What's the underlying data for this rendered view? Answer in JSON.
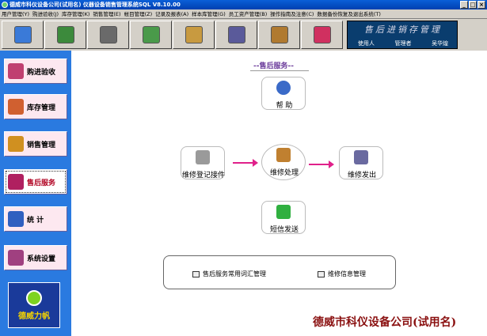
{
  "window": {
    "title": "德威市科仪设备公司(试用名) 仪器设备销售管理系统SQL V8.10.00",
    "buttons": [
      "_",
      "□",
      "×"
    ]
  },
  "menu": [
    "用户管理(Y)",
    "购进验收(J)",
    "库存管理(K)",
    "销售管理(E)",
    "帐目管理(Z)",
    "记录及报表(A)",
    "样本库管理(G)",
    "员工资产管理(B)",
    "操作指南及注意(C)",
    "数据备份恢复及退出系统(T)"
  ],
  "toolbar": {
    "icons": [
      {
        "name": "refresh-icon",
        "color": "#3a7ad8"
      },
      {
        "name": "ledger-icon",
        "color": "#3c8a3c"
      },
      {
        "name": "search-icon",
        "color": "#6a6a6a"
      },
      {
        "name": "spreadsheet-icon",
        "color": "#4a9a4a"
      },
      {
        "name": "box-icon",
        "color": "#c89a40"
      },
      {
        "name": "id-card-icon",
        "color": "#5a5a9a"
      },
      {
        "name": "book-icon",
        "color": "#b07a30"
      },
      {
        "name": "exit-door-icon",
        "color": "#d03060"
      }
    ],
    "brand_title": "售后进销存管理",
    "user_label": "使用人",
    "role_label": "管理者",
    "user_name": "吴华煌"
  },
  "sidebar": {
    "items": [
      {
        "label": "购进验收",
        "icon": "purchase-icon",
        "color": "#c04070"
      },
      {
        "label": "库存管理",
        "icon": "inventory-icon",
        "color": "#d06030"
      },
      {
        "label": "销售管理",
        "icon": "shopping-cart-icon",
        "color": "#d09020"
      },
      {
        "label": "售后服务",
        "icon": "after-sales-icon",
        "color": "#b02060"
      },
      {
        "label": "统  计",
        "icon": "statistics-icon",
        "color": "#3060c0"
      },
      {
        "label": "系统设置",
        "icon": "settings-icon",
        "color": "#a04080"
      }
    ],
    "active_index": 3,
    "logo_text": "德威力帆"
  },
  "main": {
    "section_title": "--售后服务--",
    "help_label": "帮  助",
    "repair_register_label": "维修登记接件",
    "repair_process_label": "维修处理",
    "repair_dispatch_label": "维修发出",
    "sms_label": "短信发送",
    "vocab_manage_label": "售后服务常用词汇管理",
    "repair_info_label": "维修信息管理",
    "company_name": "德威市科仪设备公司(试用名)"
  }
}
